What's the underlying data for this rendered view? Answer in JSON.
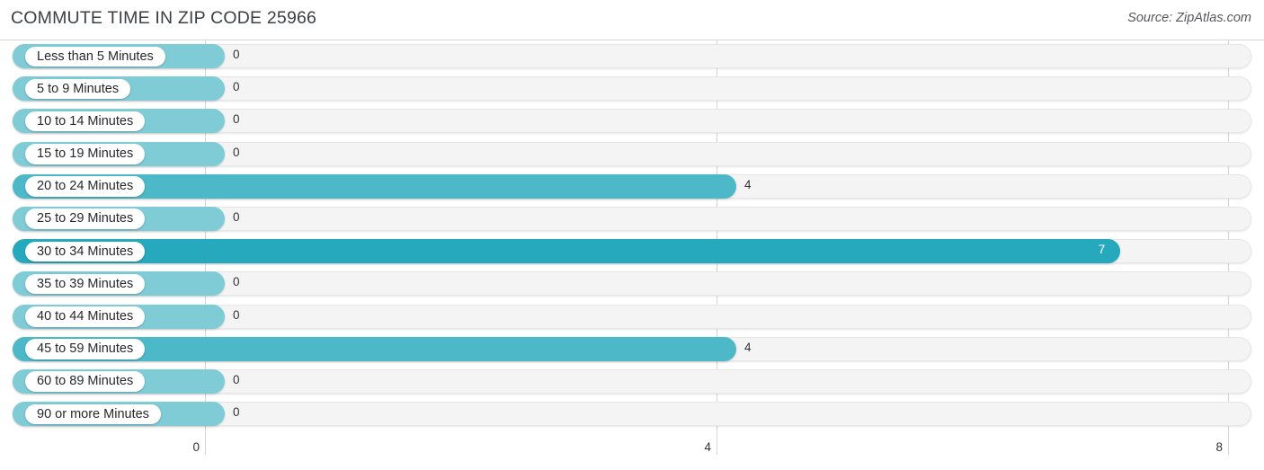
{
  "header": {
    "title": "COMMUTE TIME IN ZIP CODE 25966",
    "source": "Source: ZipAtlas.com"
  },
  "colors": {
    "bar_zero": "#7fcbd6",
    "bar_mid": "#4cb8c8",
    "bar_high": "#26a8bd",
    "track_fill": "#f4f4f4",
    "track_border": "#e6e6e6",
    "gridline": "#d6d6d6",
    "title_text": "#3c4043",
    "value_text": "#303236"
  },
  "chart_data": {
    "type": "bar",
    "orientation": "horizontal",
    "title": "COMMUTE TIME IN ZIP CODE 25966",
    "xlabel": "",
    "ylabel": "",
    "xlim": [
      0,
      8
    ],
    "grid": true,
    "legend": null,
    "xticks": [
      0,
      4,
      8
    ],
    "xtick_labels": [
      "0",
      "4",
      "8"
    ],
    "categories": [
      "Less than 5 Minutes",
      "5 to 9 Minutes",
      "10 to 14 Minutes",
      "15 to 19 Minutes",
      "20 to 24 Minutes",
      "25 to 29 Minutes",
      "30 to 34 Minutes",
      "35 to 39 Minutes",
      "40 to 44 Minutes",
      "45 to 59 Minutes",
      "60 to 89 Minutes",
      "90 or more Minutes"
    ],
    "values": [
      0,
      0,
      0,
      0,
      4,
      0,
      7,
      0,
      0,
      4,
      0,
      0
    ],
    "value_labels": [
      "0",
      "0",
      "0",
      "0",
      "4",
      "0",
      "7",
      "0",
      "0",
      "4",
      "0",
      "0"
    ]
  }
}
